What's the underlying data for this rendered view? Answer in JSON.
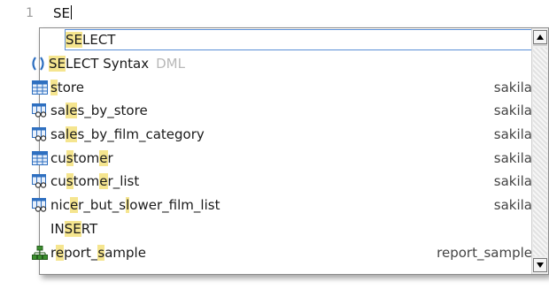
{
  "editor": {
    "line_number": "1",
    "typed_text": "SE"
  },
  "popup": {
    "items": [
      {
        "icon": "none",
        "prefix": "SE",
        "rest": "LECT",
        "schema": "",
        "selected": true
      },
      {
        "icon": "parens-icon",
        "prefix": "SE",
        "rest": "LECT Syntax",
        "suffix": "DML",
        "schema": ""
      },
      {
        "icon": "table-icon",
        "label": "store",
        "schema": "sakila"
      },
      {
        "icon": "view-icon",
        "label": "sales_by_store",
        "schema": "sakila"
      },
      {
        "icon": "view-icon",
        "label": "sales_by_film_category",
        "schema": "sakila"
      },
      {
        "icon": "table-icon",
        "label": "customer",
        "schema": "sakila"
      },
      {
        "icon": "view-icon",
        "label": "customer_list",
        "schema": "sakila"
      },
      {
        "icon": "view-icon",
        "label": "nicer_but_slower_film_list",
        "schema": "sakila"
      },
      {
        "icon": "none",
        "label": "INSERT",
        "schema": ""
      },
      {
        "icon": "schema-icon",
        "label": "report_sample",
        "schema": "report_sample"
      }
    ]
  },
  "colors": {
    "highlight": "#f5e58f",
    "selection_border": "#5a8fd6",
    "table_icon": "#2e6fc0",
    "schema_icon": "#3b8f2e"
  }
}
